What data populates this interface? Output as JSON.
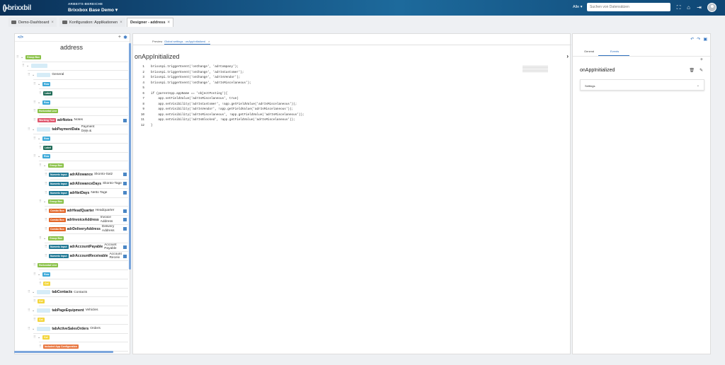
{
  "app": {
    "logo_text": "brixxbil",
    "workspace_label": "ARBEITS-BEREICHE",
    "workspace_name": "Brixxbox Base Demo",
    "search_scope": "Alle",
    "search_placeholder": "Suchen von Datensätzen"
  },
  "tabs": [
    {
      "label": "Demo-Dashboard"
    },
    {
      "label": "Konfiguration: Applikationen"
    },
    {
      "label": "Designer - address"
    }
  ],
  "left_panel": {
    "code_icon": "</>",
    "title": "address",
    "tree": [
      {
        "tag": "Group Box",
        "type": "group",
        "indent": 0,
        "vis": true
      },
      {
        "tag": "Tab Control",
        "type": "tab",
        "indent": 1,
        "vis": true
      },
      {
        "tag": "Tab Page",
        "type": "tab",
        "indent": 2,
        "vis": true,
        "label": "General"
      },
      {
        "tag": "Row",
        "type": "row",
        "indent": 3,
        "vis": true
      },
      {
        "tag": "Label",
        "type": "label",
        "indent": 4,
        "vis": false
      },
      {
        "tag": "Row",
        "type": "row",
        "indent": 3,
        "vis": true
      },
      {
        "tag": "Horizontal Line",
        "type": "hl",
        "indent": 3,
        "vis": false
      },
      {
        "tag": "Working Text",
        "type": "warn",
        "indent": 3,
        "vis": false,
        "bname": "adrNotes",
        "label": "Notes",
        "sq": true
      },
      {
        "tag": "Tab Page",
        "type": "tab",
        "indent": 2,
        "vis": true,
        "bname": "tabPaymentData",
        "label": "Payment Data & Addresses"
      },
      {
        "tag": "Row",
        "type": "row",
        "indent": 3,
        "vis": true
      },
      {
        "tag": "Label",
        "type": "label",
        "indent": 4,
        "vis": false
      },
      {
        "tag": "Row",
        "type": "row",
        "indent": 3,
        "vis": true
      },
      {
        "tag": "Group Box",
        "type": "group",
        "indent": 4,
        "vis": true
      },
      {
        "tag": "Numeric Input",
        "type": "num",
        "indent": 5,
        "vis": false,
        "bname": "adrAllowance",
        "label": "Skonto-Satz",
        "sq": true
      },
      {
        "tag": "Numeric Input",
        "type": "num",
        "indent": 5,
        "vis": false,
        "bname": "adrAllowanceDays",
        "label": "Skonto-Tage",
        "sq": true
      },
      {
        "tag": "Numeric Input",
        "type": "num",
        "indent": 5,
        "vis": false,
        "bname": "adrNetDays",
        "label": "Netto Tage",
        "sq": true
      },
      {
        "tag": "Group Box",
        "type": "group",
        "indent": 4,
        "vis": true
      },
      {
        "tag": "Combo Box",
        "type": "combo",
        "indent": 5,
        "vis": false,
        "bname": "adrHeadQuarter",
        "label": "Headquarter",
        "sq": true
      },
      {
        "tag": "Combo Box",
        "type": "combo",
        "indent": 5,
        "vis": false,
        "bname": "adrInvoiceAddress",
        "label": "Invoice Address",
        "sq": true
      },
      {
        "tag": "Combo Box",
        "type": "combo",
        "indent": 5,
        "vis": false,
        "bname": "adrDeliveryAddress",
        "label": "Delivery Address",
        "sq": true
      },
      {
        "tag": "Group Box",
        "type": "group",
        "indent": 4,
        "vis": true
      },
      {
        "tag": "Numeric Input",
        "type": "num",
        "indent": 5,
        "vis": false,
        "bname": "adrAccountPayable",
        "label": "Account Payable",
        "sq": true
      },
      {
        "tag": "Numeric Input",
        "type": "num",
        "indent": 5,
        "vis": false,
        "bname": "adrAccountReceivable",
        "label": "Account Receiv",
        "sq": true
      },
      {
        "tag": "Horizontal Line",
        "type": "hl",
        "indent": 3,
        "vis": false
      },
      {
        "tag": "Row",
        "type": "row",
        "indent": 3,
        "vis": true
      },
      {
        "tag": "Col",
        "type": "yel",
        "indent": 4,
        "vis": false
      },
      {
        "tag": "Tab Page",
        "type": "tab",
        "indent": 2,
        "vis": true,
        "bname": "tabContacts",
        "label": "Contacts"
      },
      {
        "tag": "Col",
        "type": "yel",
        "indent": 3,
        "vis": false
      },
      {
        "tag": "Tab Page",
        "type": "tab",
        "indent": 2,
        "vis": true,
        "bname": "tabPageEquipment",
        "label": "Vehicles"
      },
      {
        "tag": "Col",
        "type": "yel",
        "indent": 3,
        "vis": false
      },
      {
        "tag": "Tab Page",
        "type": "tab",
        "indent": 2,
        "vis": true,
        "bname": "tabActiveSalesOrders",
        "label": "Orders"
      },
      {
        "tag": "Col",
        "type": "yel",
        "indent": 3,
        "vis": true
      },
      {
        "tag": "Included App Configuration",
        "type": "incl",
        "indent": 4,
        "vis": false
      }
    ]
  },
  "editor": {
    "tabs": [
      {
        "label": "Preview"
      },
      {
        "label": "Global settings : onAppInitialized"
      }
    ],
    "title": "onAppInitialized",
    "code": [
      "brixxApi.triggerEvent('onChange', 'adrCompany');",
      "brixxApi.triggerEvent('onChange', 'adrIsCustomer');",
      "brixxApi.triggerEvent('onChange', 'adrIsVendor');",
      "brixxApi.triggerEvent('onChange', 'adrIsMiscelaneous');",
      "",
      "if (parentApp.appName == 'objectPosting'){",
      "    app.setFieldValue('adrIsMiscelaneous', true)",
      "    app.setVisibility('adrIsCustomer', !app.getFieldValue('adrIsMiscelaneous'));",
      "    app.setVisibility('adrIsVendor', !app.getFieldValue('adrIsMiscelaneous'));",
      "    app.setVisibility('adrIsMiscelaneous', !app.getFieldValue('adrIsMiscelaneous'));",
      "    app.setVisibility('adrIsBlocked', !app.getFieldValue('adrIsMiscelaneous'));",
      "}"
    ]
  },
  "right_panel": {
    "tabs": [
      {
        "label": "General"
      },
      {
        "label": "Events"
      }
    ],
    "event_name": "onAppInitialized",
    "settings_label": "Settings"
  }
}
